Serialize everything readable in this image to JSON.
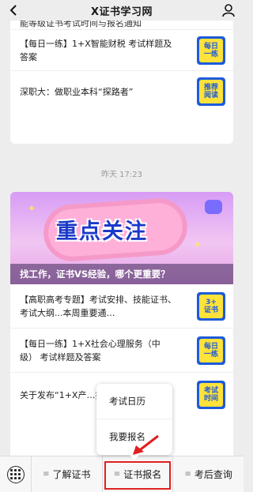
{
  "header": {
    "title": "X证书学习网",
    "back_icon": "chevron-left-icon",
    "profile_icon": "person-icon"
  },
  "feed_top": {
    "partial_title": "能等级证书考试时间与报名通知",
    "articles": [
      {
        "title": "【每日一练】1+X智能财税 考试样题及答案",
        "thumb": "每日\n一练"
      },
      {
        "title": "深职大：做职业本科“探路者”",
        "thumb": "推荐\n阅读"
      }
    ]
  },
  "timestamp": "昨天 17:23",
  "feed_bottom": {
    "banner": {
      "headline": "重点关注",
      "subtitle": "找工作，证书VS经验，哪个更重要？"
    },
    "articles": [
      {
        "title": "【高职高考专题】考试安排、技能证书、考试大纲...本周重要通…",
        "thumb": "3+\n证书"
      },
      {
        "title": "【每日一练】1+X社会心理服务（中级） 考试样题及答案",
        "thumb": "每日\n一练"
      },
      {
        "title": "关于发布“1+X产…技能等级证书”20…",
        "thumb": "考试\n时间"
      }
    ]
  },
  "popup_menu": {
    "items": [
      "考试日历",
      "我要报名"
    ]
  },
  "bottom_nav": {
    "keyboard_icon": "keyboard-icon",
    "tabs": [
      "了解证书",
      "证书报名",
      "考后查询"
    ]
  },
  "colors": {
    "thumb_bg": "#1d5bd9",
    "thumb_fg": "#ffe23a",
    "annotation_red": "#e02020"
  }
}
